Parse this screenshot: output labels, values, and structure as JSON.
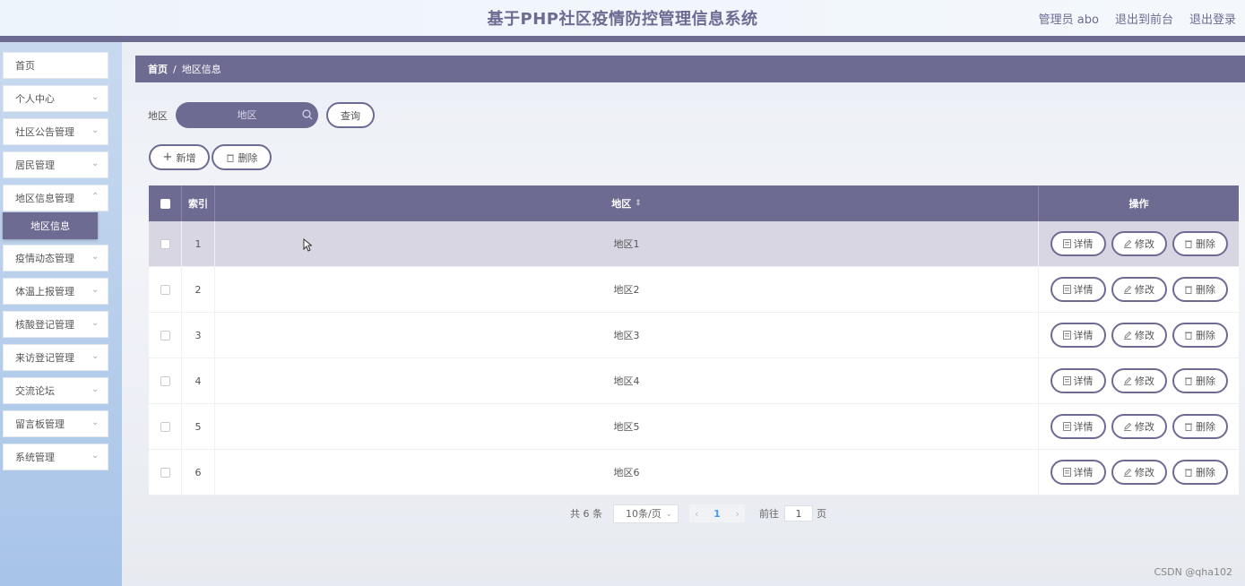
{
  "header": {
    "title": "基于PHP社区疫情防控管理信息系统",
    "user": "管理员 abo",
    "front_link": "退出到前台",
    "logout_link": "退出登录"
  },
  "sidebar": {
    "items": [
      {
        "label": "首页"
      },
      {
        "label": "个人中心"
      },
      {
        "label": "社区公告管理"
      },
      {
        "label": "居民管理"
      },
      {
        "label": "地区信息管理"
      },
      {
        "label": "疫情动态管理"
      },
      {
        "label": "体温上报管理"
      },
      {
        "label": "核酸登记管理"
      },
      {
        "label": "来访登记管理"
      },
      {
        "label": "交流论坛"
      },
      {
        "label": "留言板管理"
      },
      {
        "label": "系统管理"
      }
    ],
    "active_sub": "地区信息"
  },
  "breadcrumb": {
    "home": "首页",
    "sep": "/",
    "current": "地区信息"
  },
  "search": {
    "label": "地区",
    "placeholder": "地区",
    "query_btn": "查询"
  },
  "actions": {
    "add": "新增",
    "delete": "删除"
  },
  "table": {
    "headers": {
      "index": "索引",
      "area": "地区",
      "ops": "操作"
    },
    "rows": [
      {
        "index": "1",
        "area": "地区1"
      },
      {
        "index": "2",
        "area": "地区2"
      },
      {
        "index": "3",
        "area": "地区3"
      },
      {
        "index": "4",
        "area": "地区4"
      },
      {
        "index": "5",
        "area": "地区5"
      },
      {
        "index": "6",
        "area": "地区6"
      }
    ],
    "op_labels": {
      "detail": "详情",
      "edit": "修改",
      "delete": "删除"
    }
  },
  "pager": {
    "total": "共 6 条",
    "page_size": "10条/页",
    "current_page": "1",
    "goto_label": "前往",
    "goto_value": "1",
    "unit": "页"
  },
  "watermark": "CSDN @qha102",
  "colors": {
    "accent": "#6e6b93",
    "sidebar_bg": "#a8c4e8"
  }
}
